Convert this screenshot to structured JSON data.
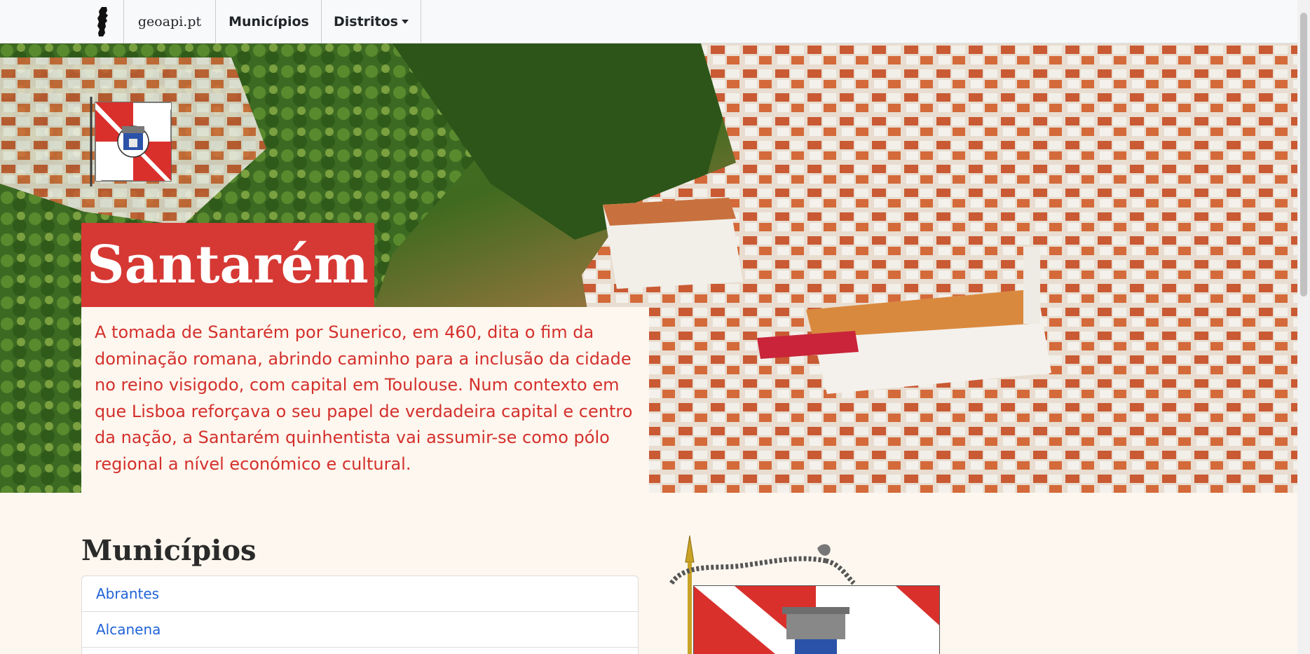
{
  "navbar": {
    "brand": "geoapi.pt",
    "municipios_link": "Municípios",
    "distritos_dropdown": "Distritos"
  },
  "hero": {
    "title": "Santarém",
    "description": "A tomada de Santarém por Sunerico, em 460, dita o fim da dominação romana, abrindo caminho para a inclusão da cidade no reino visigodo, com capital em Toulouse. Num contexto em que Lisboa reforçava o seu papel de verdadeira capital e centro da nação, a Santarém quinhentista vai assumir-se como pólo regional a nível económico e cultural."
  },
  "municipios": {
    "title": "Municípios",
    "items": [
      "Abrantes",
      "Alcanena",
      ""
    ]
  },
  "colors": {
    "accent_red": "#d63834",
    "text_red": "#d4302c",
    "link_blue": "#1f63d6",
    "page_bg": "#fdf7ef"
  }
}
